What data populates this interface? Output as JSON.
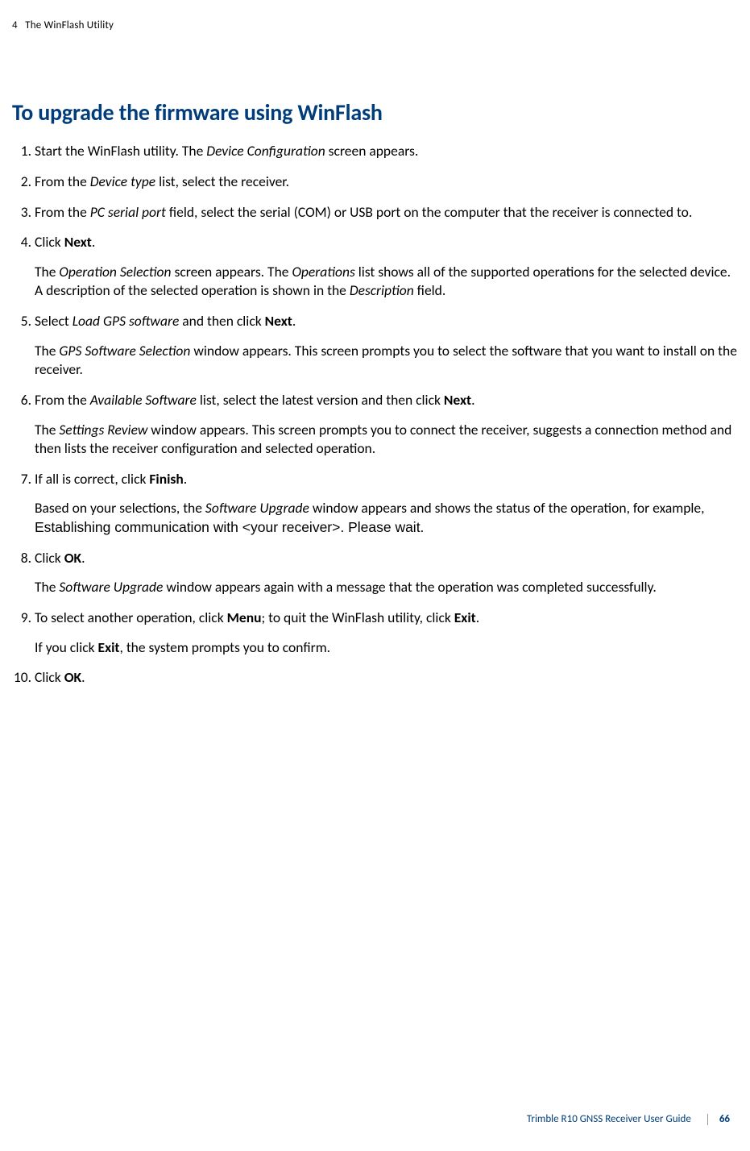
{
  "header": {
    "chapter_num": "4",
    "chapter_title": "The WinFlash Utility"
  },
  "title": "To upgrade the firmware using WinFlash",
  "steps": {
    "s1": {
      "t1": "Start the WinFlash utility. The ",
      "e1": "Device Configuration",
      "t2": " screen appears."
    },
    "s2": {
      "t1": "From the ",
      "e1": "Device type",
      "t2": " list, select the receiver."
    },
    "s3": {
      "t1": "From the ",
      "e1": "PC serial port",
      "t2": " field, select the serial (COM) or USB port on the computer that the receiver is connected to."
    },
    "s4": {
      "p1_t1": "Click ",
      "p1_b1": "Next",
      "p1_t2": ".",
      "p2_t1": "The ",
      "p2_e1": "Operation Selection",
      "p2_t2": " screen appears. The ",
      "p2_e2": "Operations",
      "p2_t3": " list shows all of the supported operations for the selected device. A description of the selected operation is shown in the ",
      "p2_e3": "Description",
      "p2_t4": " field."
    },
    "s5": {
      "p1_t1": "Select ",
      "p1_e1": "Load GPS software",
      "p1_t2": " and then click ",
      "p1_b1": "Next",
      "p1_t3": ".",
      "p2_t1": "The ",
      "p2_e1": "GPS Software Selection",
      "p2_t2": " window appears. This screen prompts you to select the software that you want to install on the receiver."
    },
    "s6": {
      "p1_t1": "From the ",
      "p1_e1": "Available Software",
      "p1_t2": " list, select the latest version and then click ",
      "p1_b1": "Next",
      "p1_t3": ".",
      "p2_t1": "The ",
      "p2_e1": "Settings Review",
      "p2_t2": " window appears. This screen prompts you to connect the receiver, suggests a connection method and then lists the receiver configuration and selected operation."
    },
    "s7": {
      "p1_t1": "If all is correct, click ",
      "p1_b1": "Finish",
      "p1_t2": ".",
      "p2_t1": "Based on your selections, the ",
      "p2_e1": "Software Upgrade",
      "p2_t2": " window appears and shows the status of the operation, for example, ",
      "p2_alt1": "Establishing communication with <your receiver>. Please wait."
    },
    "s8": {
      "p1_t1": "Click ",
      "p1_b1": "OK",
      "p1_t2": ".",
      "p2_t1": "The ",
      "p2_e1": "Software Upgrade",
      "p2_t2": " window appears again with a message that the operation was completed successfully."
    },
    "s9": {
      "p1_t1": "To select another operation, click ",
      "p1_b1": "Menu",
      "p1_t2": "; to quit the WinFlash utility, click ",
      "p1_b2": "Exit",
      "p1_t3": ".",
      "p2_t1": "If you click ",
      "p2_b1": "Exit",
      "p2_t2": ", the system prompts you to confirm."
    },
    "s10": {
      "t1": "Click ",
      "b1": "OK",
      "t2": "."
    }
  },
  "footer": {
    "guide": "Trimble R10 GNSS Receiver User Guide",
    "page": "66"
  }
}
